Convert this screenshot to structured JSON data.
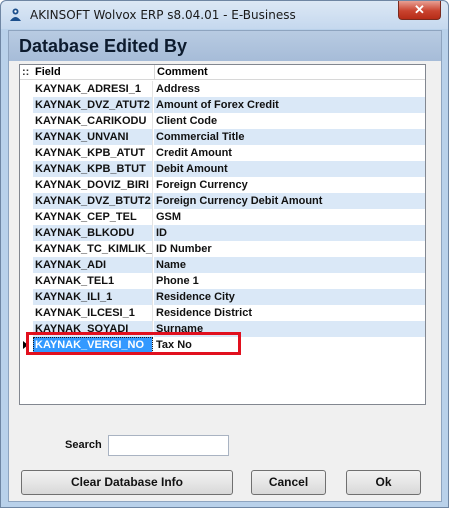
{
  "window": {
    "title": "AKINSOFT Wolvox ERP s8.04.01 - E-Business",
    "close_glyph": "✕",
    "app_icon": "wolvox-logo-icon"
  },
  "dialog": {
    "heading": "Database Edited By"
  },
  "grid": {
    "indicator_header": "::",
    "columns": [
      "Field",
      "Comment"
    ],
    "rows": [
      {
        "field": "KAYNAK_ADRESI_1",
        "comment": "Address"
      },
      {
        "field": "KAYNAK_DVZ_ATUT2",
        "comment": "Amount of Forex Credit"
      },
      {
        "field": "KAYNAK_CARIKODU",
        "comment": "Client Code"
      },
      {
        "field": "KAYNAK_UNVANI",
        "comment": "Commercial Title"
      },
      {
        "field": "KAYNAK_KPB_ATUT",
        "comment": "Credit Amount"
      },
      {
        "field": "KAYNAK_KPB_BTUT",
        "comment": "Debit Amount"
      },
      {
        "field": "KAYNAK_DOVIZ_BIRI",
        "comment": "Foreign Currency"
      },
      {
        "field": "KAYNAK_DVZ_BTUT2",
        "comment": "Foreign Currency Debit Amount"
      },
      {
        "field": "KAYNAK_CEP_TEL",
        "comment": "GSM"
      },
      {
        "field": "KAYNAK_BLKODU",
        "comment": "ID"
      },
      {
        "field": "KAYNAK_TC_KIMLIK_",
        "comment": "ID Number"
      },
      {
        "field": "KAYNAK_ADI",
        "comment": "Name"
      },
      {
        "field": "KAYNAK_TEL1",
        "comment": "Phone 1"
      },
      {
        "field": "KAYNAK_ILI_1",
        "comment": "Residence City"
      },
      {
        "field": "KAYNAK_ILCESI_1",
        "comment": "Residence District"
      },
      {
        "field": "KAYNAK_SOYADI",
        "comment": "Surname"
      },
      {
        "field": "KAYNAK_VERGI_NO",
        "comment": "Tax No"
      }
    ],
    "selected_index": 16,
    "alt_row_color": "#dae8f7",
    "selection_color": "#3399ff",
    "highlight_color": "#e1101e"
  },
  "search": {
    "label": "Search",
    "value": "",
    "placeholder": ""
  },
  "buttons": {
    "clear": "Clear Database Info",
    "cancel": "Cancel",
    "ok": "Ok"
  }
}
